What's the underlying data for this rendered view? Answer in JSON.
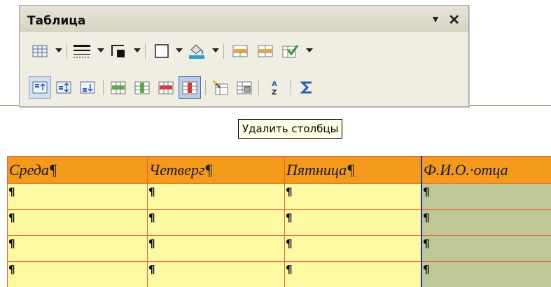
{
  "toolbar": {
    "title": "Таблица",
    "menu_glyph": "▼",
    "close_glyph": "✕",
    "row1": [
      {
        "name": "table-icon",
        "dropdown": true
      },
      {
        "name": "border-style-icon",
        "dropdown": true
      },
      {
        "name": "border-color-icon",
        "dropdown": true
      },
      {
        "name": "borders-icon",
        "dropdown": true
      },
      {
        "name": "background-color-icon",
        "dropdown": true
      },
      {
        "name": "merge-cells-icon",
        "dropdown": false
      },
      {
        "name": "split-cells-icon",
        "dropdown": false
      },
      {
        "name": "optimize-icon",
        "dropdown": true
      }
    ],
    "row2": [
      {
        "name": "align-top-icon",
        "state": "pressed"
      },
      {
        "name": "align-center-icon"
      },
      {
        "name": "align-bottom-icon"
      },
      {
        "name": "insert-rows-icon"
      },
      {
        "name": "insert-columns-icon"
      },
      {
        "name": "delete-rows-icon"
      },
      {
        "name": "delete-columns-icon",
        "state": "hover"
      },
      {
        "name": "autoformat-icon"
      },
      {
        "name": "table-properties-icon"
      },
      {
        "name": "sort-icon"
      },
      {
        "name": "sum-icon"
      }
    ]
  },
  "tooltip": {
    "text": "Удалить столбцы"
  },
  "table": {
    "headers": [
      "Среда¶",
      "Четверг¶",
      "Пятница¶",
      "Ф.И.О.·отца"
    ],
    "rows": [
      [
        "¶",
        "¶",
        "¶",
        "¶"
      ],
      [
        "¶",
        "¶",
        "¶",
        "¶"
      ],
      [
        "¶",
        "¶",
        "¶",
        "¶"
      ],
      [
        "¶",
        "¶",
        "¶",
        "¶"
      ]
    ]
  },
  "colors": {
    "header_bg": "#f39a1d",
    "cell_bg": "#fdf9a2",
    "selected_cell_bg": "#c0c797",
    "grid_line": "#e8663c",
    "selected_border": "#1f3a8a"
  }
}
